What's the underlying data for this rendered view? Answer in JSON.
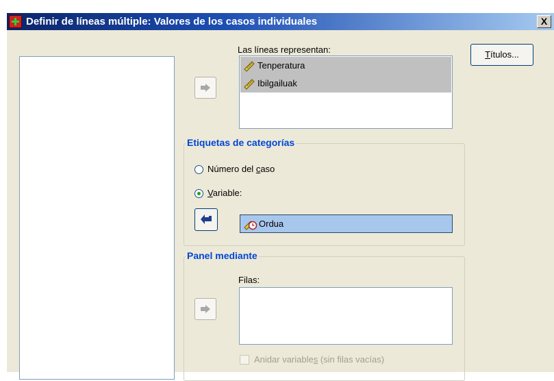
{
  "window": {
    "title": "Definir de líneas múltiple: Valores de los casos individuales",
    "close_label": "X"
  },
  "lines": {
    "label": "Las líneas representan:",
    "items": [
      {
        "label": "Tenperatura",
        "icon": "ruler-scale-icon"
      },
      {
        "label": "Ibilgailuak",
        "icon": "ruler-scale-icon"
      }
    ]
  },
  "titles_button": {
    "label_first": "T",
    "label_rest": "ítulos..."
  },
  "category_labels": {
    "legend": "Etiquetas de categorías",
    "option_case": {
      "pre": "Número del ",
      "mnemonic": "c",
      "post": "aso",
      "checked": false
    },
    "option_variable": {
      "pre": "",
      "mnemonic": "V",
      "post": "ariable:",
      "checked": true
    },
    "variable_value": "Ordua",
    "variable_icon": "ordinal-scale-icon"
  },
  "panel": {
    "legend": "Panel mediante",
    "rows_label": "Filas:",
    "nest_checkbox": {
      "pre": "Anidar variable",
      "mnemonic": "s",
      "post": " (sin filas vacías)",
      "checked": false,
      "disabled": true
    }
  }
}
